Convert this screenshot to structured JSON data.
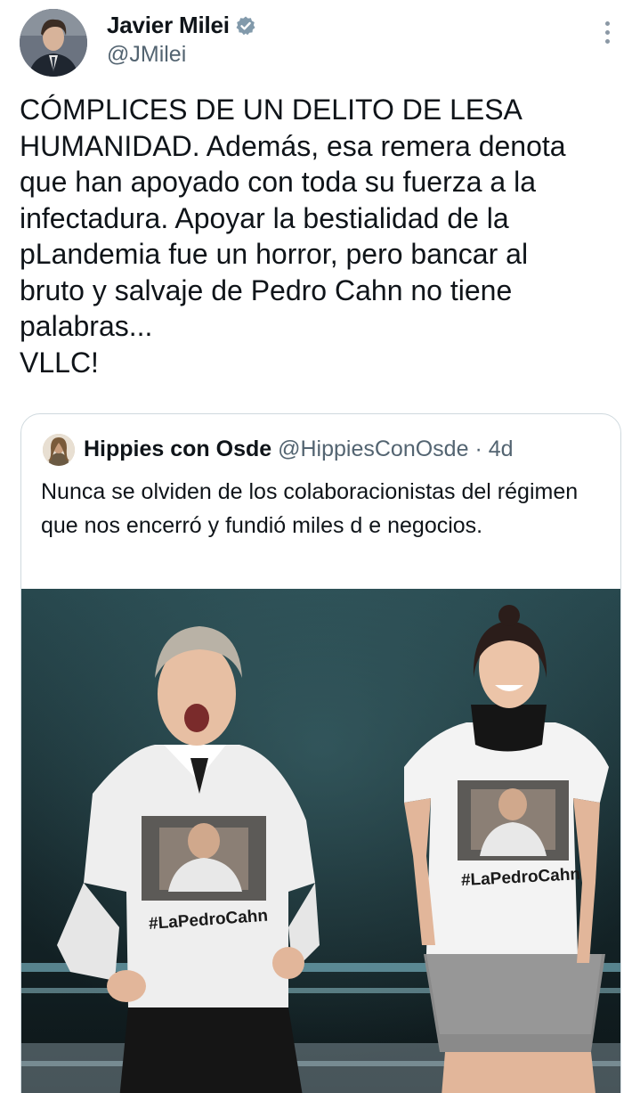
{
  "author": {
    "display_name": "Javier Milei",
    "handle": "@JMilei",
    "verified": true,
    "avatar_icon": "author-avatar"
  },
  "more_icon": "more-options-icon",
  "tweet": {
    "text": "CÓMPLICES DE UN DELITO DE LESA\nHUMANIDAD. Además, esa remera denota\nque han apoyado con toda su fuerza a la\ninfectadura. Apoyar la bestialidad de la\npLandemia fue un horror, pero bancar al\nbruto y salvaje de Pedro Cahn no tiene\npalabras...\nVLLC!"
  },
  "quoted": {
    "display_name": "Hippies con Osde",
    "handle": "@HippiesConOsde",
    "separator": "·",
    "time": "4d",
    "text": "Nunca se olviden de los colaboracionistas del régimen que nos encerró y fundió miles d e negocios.",
    "image": {
      "shirt_text_left": "#LaPedroCahn",
      "shirt_text_right": "#LaPedroCahn"
    }
  },
  "colors": {
    "text": "#0f1419",
    "secondary": "#536471",
    "border": "#cfd9de",
    "verified": "#829aab"
  }
}
